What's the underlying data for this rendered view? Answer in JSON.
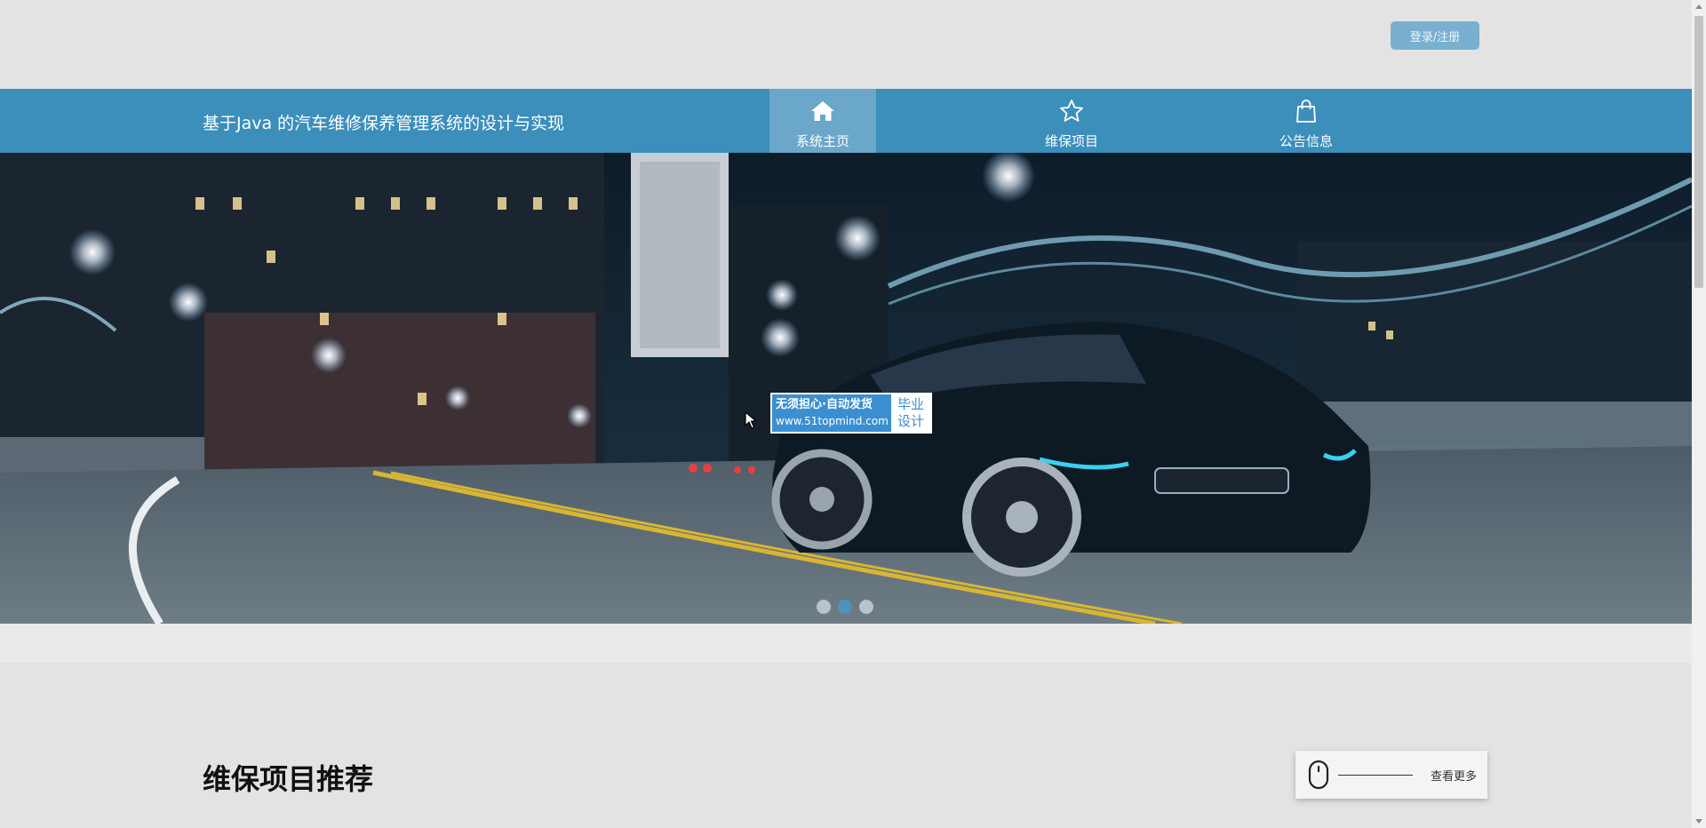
{
  "header": {
    "login_label": "登录/注册"
  },
  "nav": {
    "site_title": "基于Java 的汽车维修保养管理系统的设计与实现",
    "items": [
      {
        "label": "系统主页",
        "icon": "home-icon",
        "active": true
      },
      {
        "label": "维保项目",
        "icon": "star-icon",
        "active": false
      },
      {
        "label": "公告信息",
        "icon": "shopping-bag-icon",
        "active": false
      }
    ]
  },
  "banner": {
    "image": "night-city-bridge-sports-car-photo",
    "slide_count": 3,
    "active_slide": 2
  },
  "watermark": {
    "line1": "无须担心·自动发货",
    "line2": "www.51topmind.com",
    "right_line1": "毕业",
    "right_line2": "设计"
  },
  "recommend": {
    "title": "维保项目推荐",
    "more_label": "查看更多",
    "more_icon": "mouse-icon"
  },
  "colors": {
    "nav_bg": "#3c8ebb",
    "nav_active": "#6ba7c9",
    "login_btn": "#7ab0cf",
    "page_bg": "#e3e3e3"
  }
}
